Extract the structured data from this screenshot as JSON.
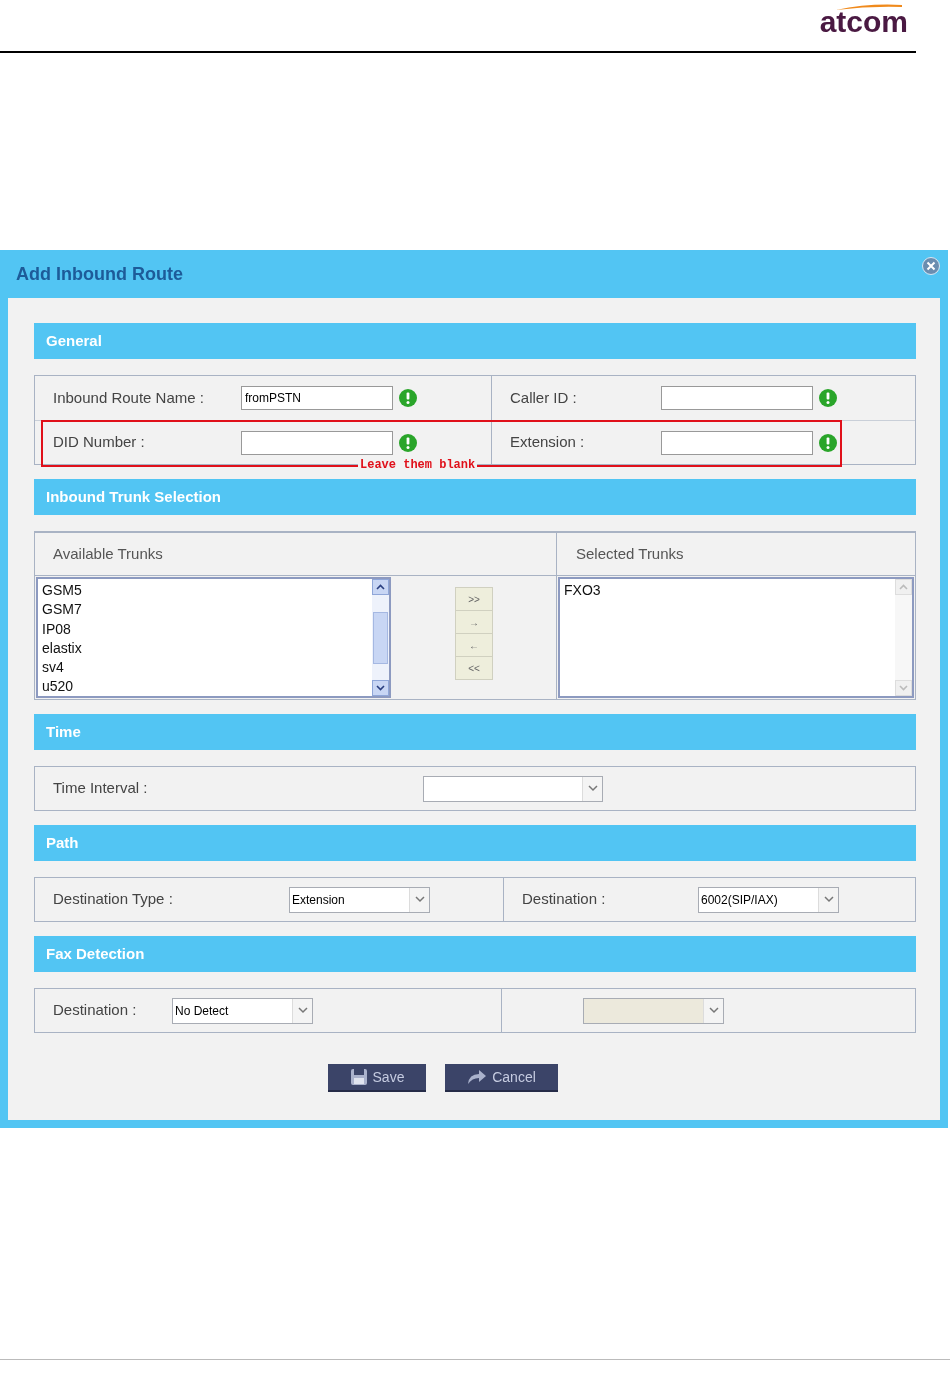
{
  "header": {
    "logo": "atcom"
  },
  "dialog": {
    "title": "Add Inbound Route",
    "general": {
      "title": "General",
      "rows": [
        {
          "cells": [
            {
              "label": "Inbound Route Name :",
              "value": "fromPSTN",
              "required": true
            },
            {
              "label": "Caller ID :",
              "required": true
            }
          ]
        },
        {
          "cells": [
            {
              "label": "DID Number :",
              "required": true
            },
            {
              "label": "Extension :",
              "required": true
            }
          ]
        }
      ],
      "annotation": {
        "text": "Leave them blank"
      }
    },
    "trunks": {
      "title": "Inbound Trunk Selection",
      "available": {
        "heading": "Available Trunks",
        "items": [
          "GSM5",
          "GSM7",
          "IP08",
          "elastix",
          "sv4",
          "u520"
        ]
      },
      "selected": {
        "heading": "Selected Trunks",
        "items": [
          "FXO3"
        ]
      },
      "move_buttons": [
        ">>",
        "→",
        "←",
        "<<"
      ]
    },
    "time": {
      "title": "Time",
      "label": "Time Interval :"
    },
    "path": {
      "title": "Path",
      "cells": [
        {
          "label": "Destination Type :",
          "value": "Extension"
        },
        {
          "label": "Destination :",
          "value": "6002(SIP/IAX)"
        }
      ]
    },
    "fax": {
      "title": "Fax Detection",
      "cells": [
        {
          "label": "Destination :",
          "value": "No Detect",
          "disabled": false
        },
        {
          "disabled": true
        }
      ]
    },
    "buttons": [
      {
        "label": "Save"
      },
      {
        "label": "Cancel"
      }
    ]
  }
}
